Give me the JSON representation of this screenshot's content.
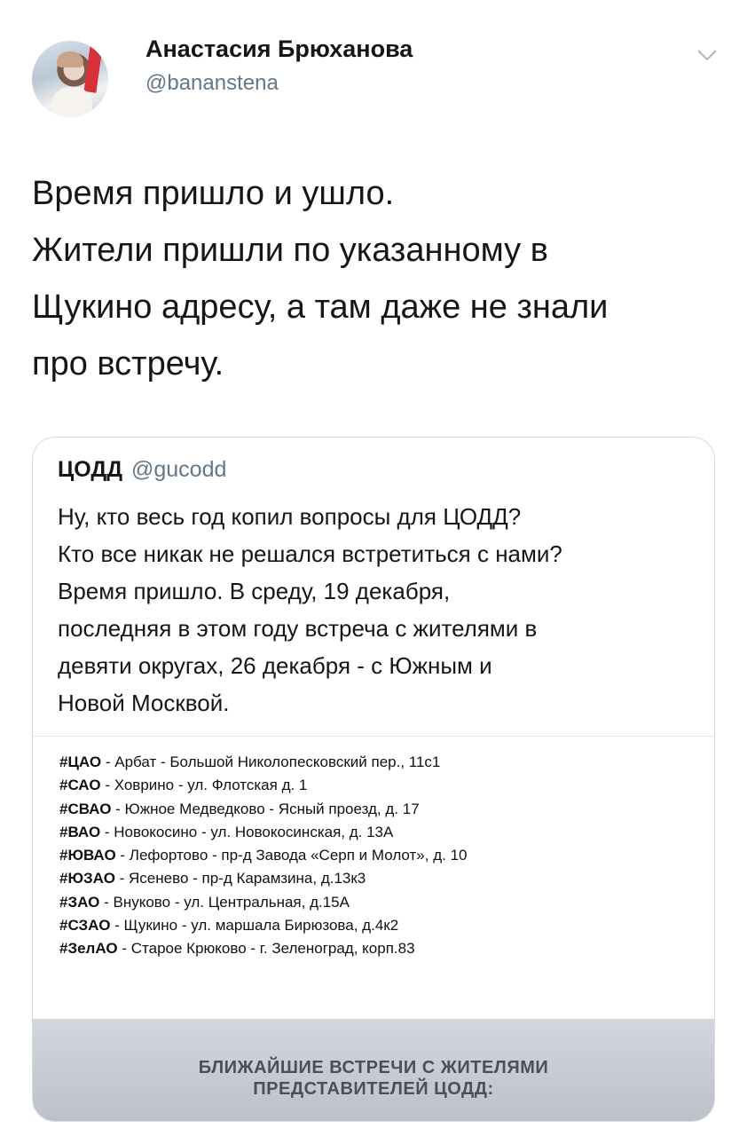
{
  "author": {
    "name": "Анастасия Брюханова",
    "handle": "@bananstena"
  },
  "tweet": {
    "lines": [
      "Время пришло и ушло.",
      "Жители пришли по указанному в",
      "Щукино адресу, а там даже не знали",
      "про встречу."
    ]
  },
  "quoted": {
    "name": "ЦОДД",
    "handle": "@gucodd",
    "lines": [
      "Ну, кто весь год копил вопросы для ЦОДД?",
      "Кто все никак не решался встретиться с нами?",
      "Время пришло. В среду, 19 декабря,",
      "последняя в этом году встреча с жителями в",
      "девяти округах, 26 декабря  - с Южным и",
      "Новой Москвой."
    ],
    "image": {
      "rows": [
        {
          "tag": "#ЦАО",
          "text": " - Арбат - Большой Николопесковский пер., 11с1"
        },
        {
          "tag": "#САО",
          "text": " - Ховрино - ул. Флотская д. 1"
        },
        {
          "tag": "#СВАО",
          "text": " - Южное Медведково - Ясный проезд, д. 17"
        },
        {
          "tag": "#ВАО",
          "text": " - Новокосино - ул. Новокосинская, д. 13А"
        },
        {
          "tag": "#ЮВАО",
          "text": " - Лефортово - пр-д Завода «Серп и Молот», д. 10"
        },
        {
          "tag": "#ЮЗАО",
          "text": " - Ясенево - пр-д Карамзина, д.13к3"
        },
        {
          "tag": "#ЗАО",
          "text": " - Внуково - ул. Центральная, д.15А"
        },
        {
          "tag": "#СЗАО",
          "text": " - Щукино - ул. маршала Бирюзова, д.4к2"
        },
        {
          "tag": "#ЗелАО",
          "text": " - Старое Крюково - г. Зеленоград, корп.83"
        }
      ],
      "banner_line1": "БЛИЖАЙШИЕ ВСТРЕЧИ С ЖИТЕЛЯМИ",
      "banner_line2": "ПРЕДСТАВИТЕЛЕЙ ЦОДД:"
    }
  },
  "icons": {
    "menu": "chevron-down-icon"
  }
}
